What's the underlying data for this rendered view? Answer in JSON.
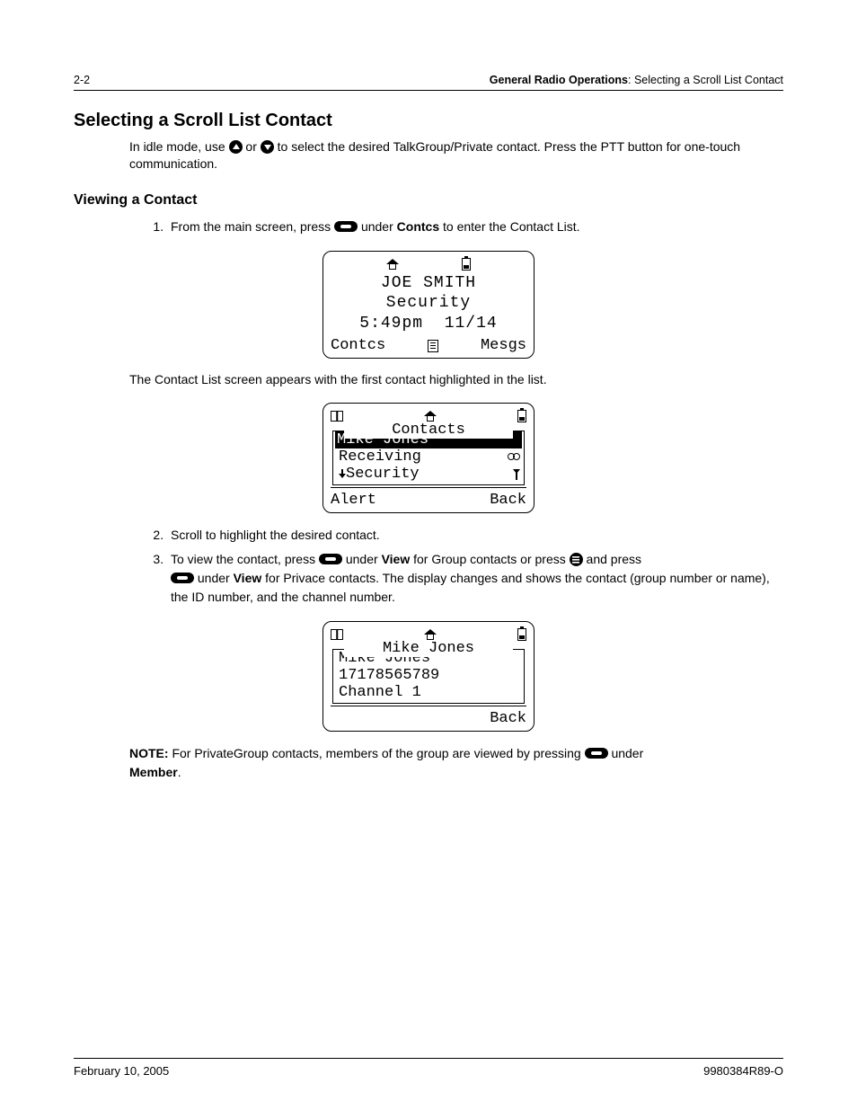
{
  "header": {
    "page_num": "2-2",
    "section": "General Radio Operations",
    "subsection": "Selecting a Scroll List Contact"
  },
  "h1": "Selecting a Scroll List Contact",
  "intro": {
    "pre": "In idle mode, use",
    "or_word": "or",
    "post": "to select the desired TalkGroup/Private contact. Press the PTT button for one-touch communication."
  },
  "h2": "Viewing a Contact",
  "step1": {
    "pre": "From the main screen, press",
    "mid": "under",
    "bold": "Contcs",
    "post": "to enter the Contact List."
  },
  "lcd1": {
    "name": "JOE SMITH",
    "group": "Security",
    "time": "5:49pm",
    "date": "11/14",
    "left_sk": "Contcs",
    "right_sk": "Mesgs"
  },
  "after_lcd1": "The Contact List screen appears with the first contact highlighted in the list.",
  "lcd2": {
    "title": "Contacts",
    "highlight": "Mike Jones",
    "row2": "Receiving",
    "row3": "Security",
    "left_sk": "Alert",
    "right_sk": "Back"
  },
  "step2": "Scroll to highlight the desired contact.",
  "step3": {
    "pre": "To view the contact, press",
    "mid1": "under",
    "bold1": "View",
    "mid2": "for Group contacts or press",
    "mid3": "and press",
    "mid4": "under",
    "bold2": "View",
    "post": "for Privace contacts. The display changes and shows the contact (group number or name), the ID number, and the channel number."
  },
  "lcd3": {
    "title": "Mike Jones",
    "row1": "Mike Jones",
    "row2": "17178565789",
    "row3": "Channel 1",
    "right_sk": "Back"
  },
  "note": {
    "label": "NOTE:",
    "pre": "For PrivateGroup contacts, members of the group are viewed by pressing",
    "mid": "under",
    "bold": "Member",
    "period": "."
  },
  "footer": {
    "date": "February 10, 2005",
    "docnum": "9980384R89-O"
  }
}
